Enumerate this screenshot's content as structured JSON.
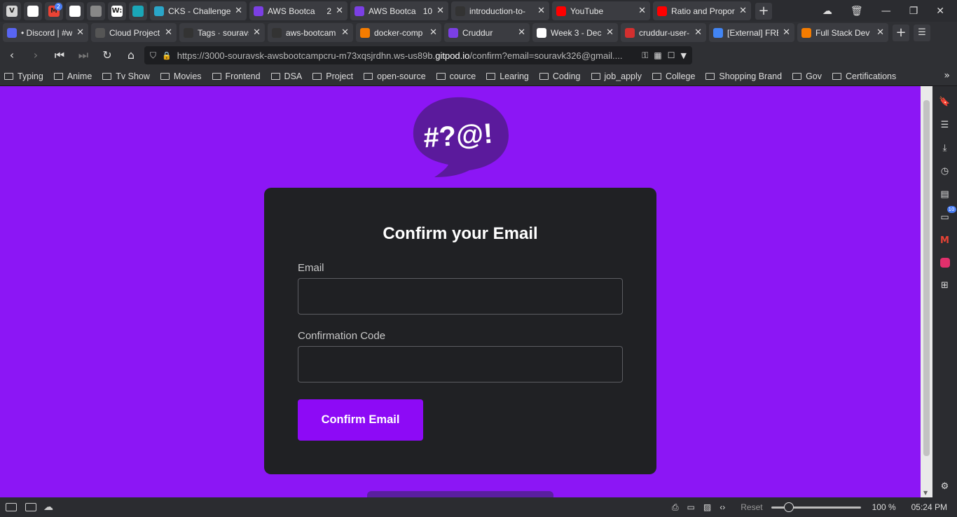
{
  "browser": {
    "pinned_tabs": [
      {
        "name": "vivaldi",
        "glyph": "V",
        "color": "#d6d6d6"
      },
      {
        "name": "github",
        "glyph": "",
        "color": "#ffffff"
      },
      {
        "name": "gmail",
        "glyph": "M",
        "color": "#ea4335",
        "badge": "2"
      },
      {
        "name": "github",
        "glyph": "",
        "color": "#ffffff"
      },
      {
        "name": "globe",
        "glyph": "",
        "color": "#888888"
      },
      {
        "name": "word",
        "glyph": "W:",
        "color": "#ffffff"
      },
      {
        "name": "app",
        "glyph": "",
        "color": "#1aa6b7"
      }
    ],
    "tabs_row1": [
      {
        "title": "CKS - Challenges",
        "color": "#2aa6c9",
        "width": 138
      },
      {
        "title": "AWS Bootca",
        "count": "2",
        "color": "#7b3fe4",
        "width": 140
      },
      {
        "title": "AWS Bootca",
        "count": "10",
        "color": "#7b3fe4",
        "width": 140
      },
      {
        "title": "introduction-to-",
        "color": "#333333",
        "width": 140
      },
      {
        "title": "YouTube",
        "color": "#ff0000",
        "width": 140
      },
      {
        "title": "Ratio and Propor",
        "color": "#ff0000",
        "width": 140
      }
    ],
    "tabs_row2": [
      {
        "title": "• Discord | #w",
        "color": "#5865f2",
        "width": 122
      },
      {
        "title": "Cloud Project",
        "color": "#555555",
        "width": 122
      },
      {
        "title": "Tags · souravs",
        "color": "#333333",
        "width": 122
      },
      {
        "title": "aws-bootcam",
        "color": "#333333",
        "width": 122
      },
      {
        "title": "docker-comp",
        "color": "#f57c00",
        "width": 122
      },
      {
        "title": "Cruddur",
        "color": "#7b3fe4",
        "width": 122
      },
      {
        "title": "Week 3 - Dec",
        "color": "#ffffff",
        "width": 122
      },
      {
        "title": "cruddur-user-",
        "color": "#d32f2f",
        "width": 122
      },
      {
        "title": "[External] FRE",
        "color": "#4285f4",
        "width": 122
      },
      {
        "title": "Full Stack Dev",
        "color": "#f57c00",
        "width": 130
      }
    ],
    "url_prefix": "https://3000-souravsk-awsbootcampcru-m73xqsjrdhn.ws-us89b.",
    "url_domain": "gitpod.io",
    "url_suffix": "/confirm?email=souravk326@gmail....",
    "bookmarks": [
      "Typing",
      "Anime",
      "Tv Show",
      "Movies",
      "Frontend",
      "DSA",
      "Project",
      "open-source",
      "cource",
      "Learing",
      "Coding",
      "job_apply",
      "College",
      "Shopping Brand",
      "Gov",
      "Certifications"
    ],
    "side_panel_badge": "10",
    "status": {
      "reset_label": "Reset",
      "zoom": "100 %",
      "zoom_fraction": 0.2,
      "time": "05:24 PM"
    }
  },
  "logo": {
    "text": "#?@!",
    "bubble_color": "#5b1a9c"
  },
  "form": {
    "title": "Confirm your Email",
    "email_label": "Email",
    "email_value": "",
    "code_label": "Confirmation Code",
    "code_value": "",
    "submit_label": "Confirm Email"
  },
  "colors": {
    "page_bg": "#8c16f5",
    "card_bg": "#202124",
    "button_bg": "#8d0af6"
  }
}
